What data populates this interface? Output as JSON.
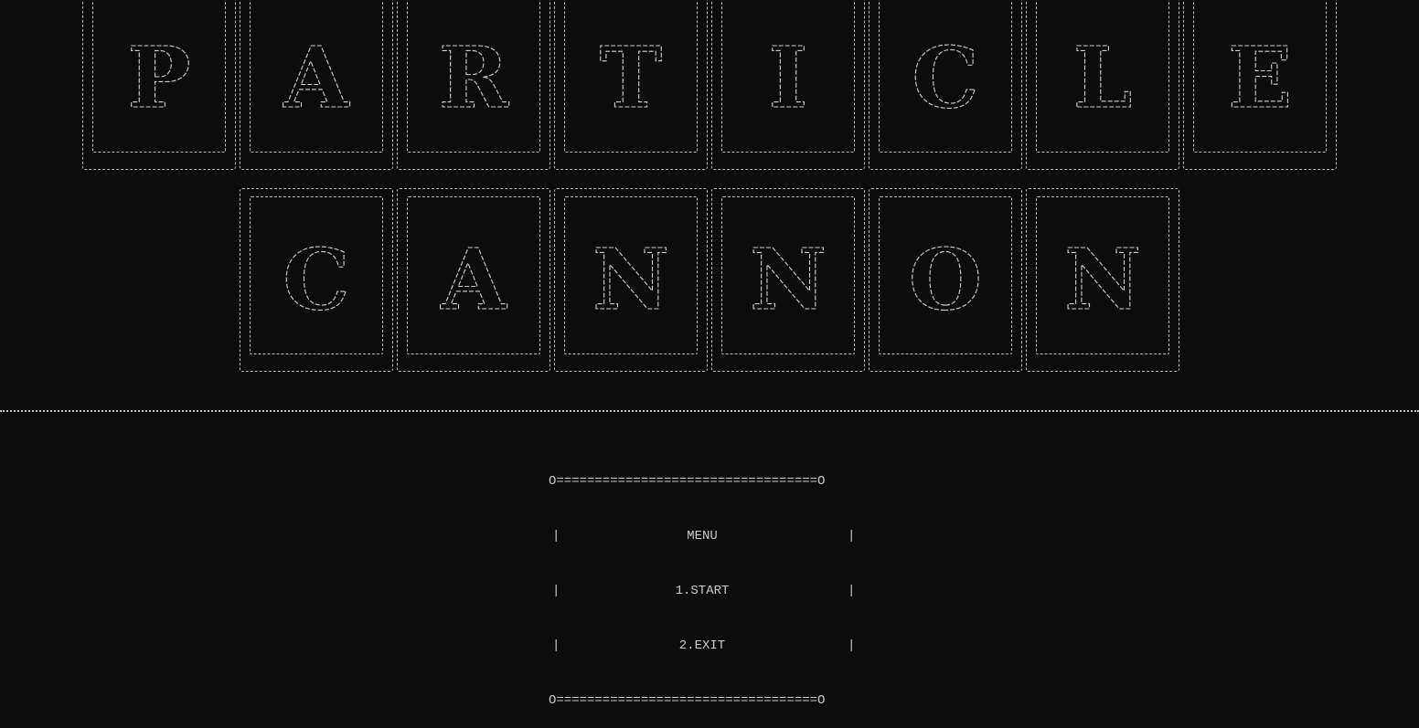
{
  "title": {
    "line1": [
      "P",
      "A",
      "R",
      "T",
      "I",
      "C",
      "L",
      "E"
    ],
    "line2": [
      "C",
      "A",
      "N",
      "N",
      "O",
      "N"
    ]
  },
  "menu": {
    "top_border": "O==================================O",
    "bottom_border": "O==================================O",
    "heading": "MENU",
    "items": [
      "1.START",
      "2.EXIT"
    ]
  }
}
